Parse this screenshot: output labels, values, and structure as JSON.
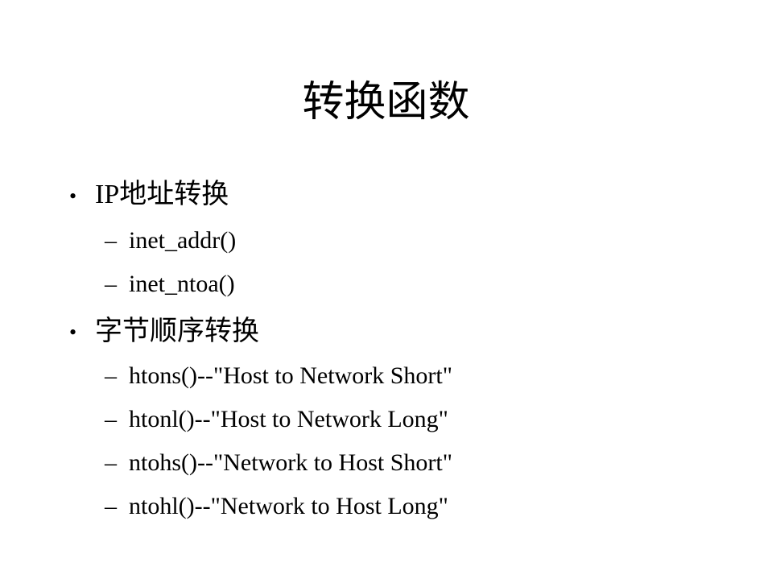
{
  "slide": {
    "title": "转换函数",
    "sections": [
      {
        "bullet": "•",
        "heading": "IP地址转换",
        "items": [
          {
            "dash": "–",
            "text": "inet_addr()"
          },
          {
            "dash": "–",
            "text": "inet_ntoa()"
          }
        ]
      },
      {
        "bullet": "•",
        "heading": "字节顺序转换",
        "items": [
          {
            "dash": "–",
            "text": "htons()--\"Host to Network Short\""
          },
          {
            "dash": "–",
            "text": "htonl()--\"Host to Network Long\""
          },
          {
            "dash": "–",
            "text": "ntohs()--\"Network to Host Short\""
          },
          {
            "dash": "–",
            "text": "ntohl()--\"Network to Host Long\""
          }
        ]
      }
    ]
  }
}
